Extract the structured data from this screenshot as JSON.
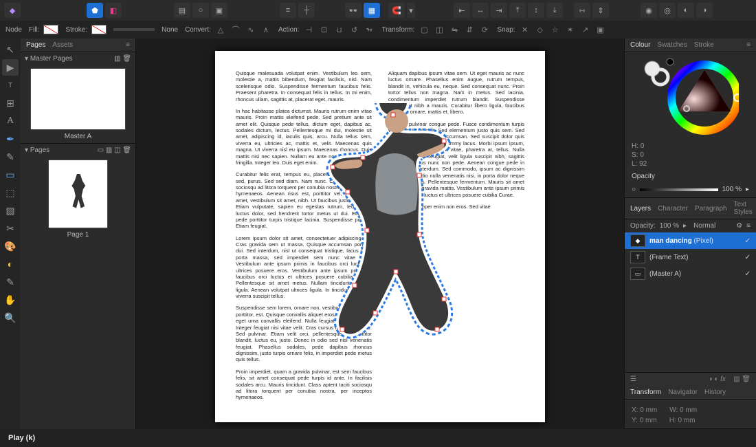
{
  "topbar": {
    "persona_icons": [
      "designer-persona",
      "artboard-persona"
    ]
  },
  "optbar": {
    "node_label": "Node",
    "fill_label": "Fill:",
    "stroke_label": "Stroke:",
    "none_label": "None",
    "convert_label": "Convert:",
    "action_label": "Action:",
    "transform_label": "Transform:",
    "snap_label": "Snap:"
  },
  "panels": {
    "pages_tab": "Pages",
    "assets_tab": "Assets",
    "master_heading": "Master Pages",
    "master_a": "Master A",
    "pages_heading": "Pages",
    "page_1": "Page 1"
  },
  "tools": [
    "move",
    "node",
    "artistic-text",
    "frame-text",
    "table",
    "pen",
    "pencil",
    "rectangle",
    "picture-frame",
    "vector-crop",
    "fill",
    "transparency",
    "hand",
    "zoom"
  ],
  "tool_glyphs": [
    "↖",
    "▶",
    "T",
    "⊞",
    "A",
    "✒",
    "✎",
    "▭",
    "⬚",
    "✂",
    "🎨",
    "◐",
    "✋",
    "🔍"
  ],
  "right": {
    "colour_tabs": [
      "Colour",
      "Swatches",
      "Stroke"
    ],
    "hsl": {
      "H": "H: 0",
      "S": "S: 0",
      "L": "L: 92"
    },
    "opacity_label": "Opacity",
    "opacity_val": "100 %",
    "layers_tabs": [
      "Layers",
      "Character",
      "Paragraph",
      "Text Styles"
    ],
    "layers_opacity_label": "Opacity:",
    "layers_opacity_val": "100 %",
    "blend": "Normal",
    "layer1": "man dancing",
    "layer1_type": "(Pixel)",
    "layer2": "(Frame Text)",
    "layer3": "(Master A)",
    "transform_tabs": [
      "Transform",
      "Navigator",
      "History"
    ],
    "x": "X:",
    "y": "Y:",
    "w": "W:",
    "h": "H:",
    "x_v": "0 mm",
    "y_v": "0 mm",
    "w_v": "0 mm",
    "h_v": "0 mm"
  },
  "footer": {
    "play": "Play (k)"
  },
  "lorem": {
    "p1": "Quisque malesuada volutpat enim. Vestibulum leo sem, molestie a, mattis bibendum, feugiat facilisis, nisl. Nam scelerisque odio. Suspendisse fermentum faucibus felis. Praesent pharetra. In consequat felis in tellus. In mi enim, rhoncus ullam, sagittis at, placerat eget, mauris.",
    "p2": "In hac habitasse platea dictumst. Mauris rutrum enim vitae mauris. Proin mattis eleifend pede. Sed pretium ante sit amet elit. Quisque pede tellus, dictum eget, dapibus ac, sodales dictum, lectus. Pellentesque mi dui, molestie sit amet, adipiscing id, iaculis quis, arcu. Nulla tellus sem, viverra eu, ultricies ac, mattis et, velit. Maecenas quis magna. Ut viverra nisl eu ipsum. Maecenas rhoncus. Duis mattis nisi nec sapien. Nullam eu ante non enim tincidunt fringilla. Integer leo. Duis eget enim.",
    "p3": "Curabitur felis erat, tempus eu, placerat et, pellentesque sed, purus. Sed sed diam. Nam nunc. Class aptent taciti sociosqu ad litora torquent per conubia nostra, per inceptos hymenaeos. Aenean risus est, porttitor vel, placerat sit amet, vestibulum sit amet, nibh. Ut faucibus justo quis nisl. Etiam vulputate, sapien eu egestas rutrum, leo neque luctus dolor, sed hendrerit tortor metus ut dui. Etiam id pede porttitor turpis tristique lacinia. Suspendisse potenti. Etiam feugiat.",
    "p4": "Lorem ipsum dolor sit amet, consectetuer adipiscing elit. Cras gravida sem ut massa. Quisque accumsan porttitor dui. Sed interdum, nisl ut consequat tristique, lacus nulla porta massa, sed imperdiet sem nunc vitae eros. Vestibulum ante ipsum primis in faucibus orci luctus et ultrices posuere eros. Vestibulum ante ipsum primis in faucibus orci luctus et ultrices posuere cubilia Curae; Pellentesque sit amet metus. Nullam tincidunt posuere ligula. Aenean volutpat ultrices ligula. In tincidunt. Aenean viverra suscipit tellus.",
    "p5": "Suspendisse sem lorem, ornare non, vestibulum ut, tempor porttitor, est. Quisque convallis aliquet eros. Nunc nec nulla eget urna convallis eleifend. Nulla feugiat eros at augue. Integer feugiat nisi vitae velit. Cras cursus ipsum vel dolor. Sed pulvinar. Etiam velit orci, pellentesque at, porttitor blandit, luctus eu, justo. Donec in odio sed nisl venenatis feugiat. Phasellus sodales, pede dapibus rhoncus dignissim, justo turpis ornare felis, in imperdiet pede metus quis tellus.",
    "p6": "Proin imperdiet, quam a gravida pulvinar, est sem faucibus felis, sit amet consequat pede turpis id ante. In facilisis sodales arcu. Mauris tincidunt. Class aptent taciti sociosqu ad litora torquent per conubia nostra, per inceptos hymenaeos.",
    "p7": "Aliquam dapibus ipsum vitae sem. Ut eget mauris ac nunc luctus ornare. Phasellus enim augue, rutrum tempus, blandit in, vehicula eu, neque. Sed consequat nunc. Proin tortor tellus non magna. Nam in metus. Sed lacinia, condimentum imperdiet rutrum blandit. Suspendisse consequat nibh a mauris. Curabitur libero ligula, faucibus at, mollis ornare, mattis et, libero.",
    "p8": "Aliquam pulvinar congue pede. Fusce condimentum turpis vel dolor. Ut blandit. Sed elementum justo quis sem. Sed eu orci eu ante iaculis accumsan. Sed suscipit dolor quis mi. Curabitur ultrices nonummy lacus. Morbi ipsum ipsum, adipiscing eget, tincidunt vitae, pharetra at, tellus. Nulla gravida, arcu et feugiat, velit ligula suscipit nibh, sagittis imperdiet metus nunc non pede. Aenean congue pede in nisi tristique interdum. Sed commodo, ipsum ac dignissim ullamcorper, odio nulla venenatis nisi, in porta dolor neque venenatis lacus. Pellentesque fermentum. Mauris sit amet ligula ut tellus gravida mattis. Vestibulum ante ipsum primis in faucibus orci luctus et ultrices posuere cubilia Curae.",
    "p9": "Vestibulum semper enim non eros. Sed vitae"
  }
}
